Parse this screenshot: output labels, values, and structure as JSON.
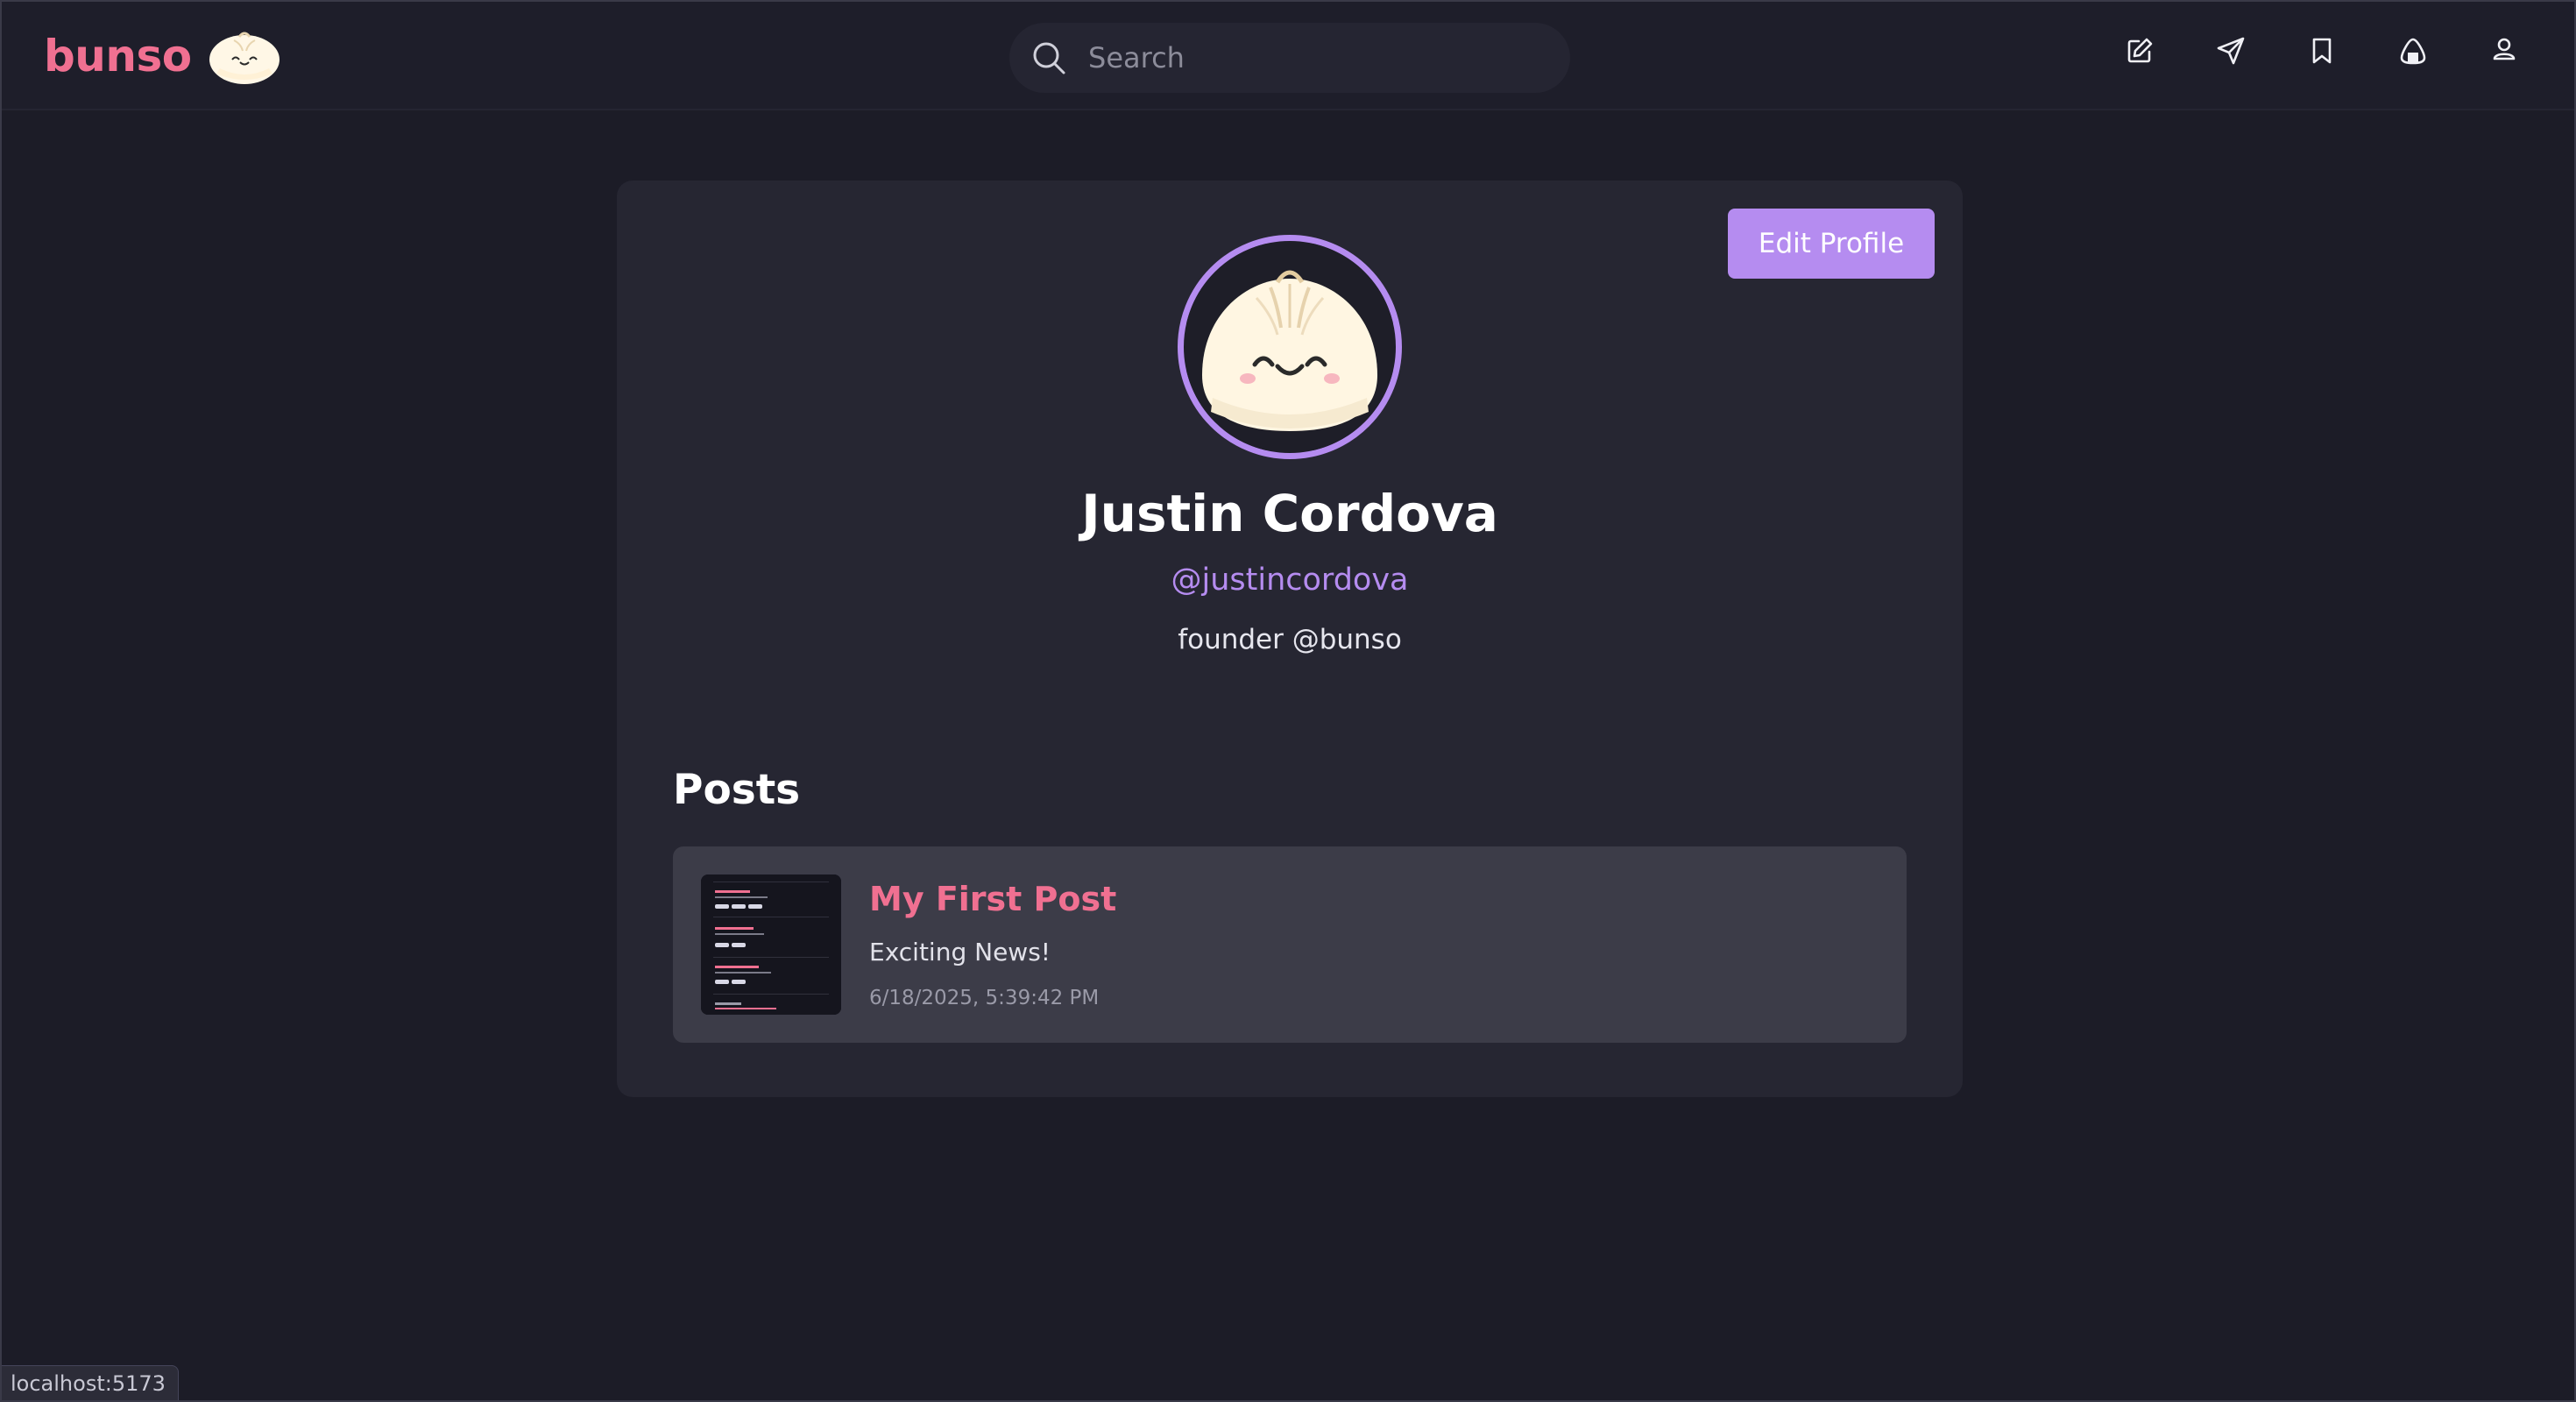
{
  "app": {
    "logo_text": "bunso"
  },
  "search": {
    "placeholder": "Search",
    "value": ""
  },
  "nav": {
    "icons": [
      "compose-icon",
      "send-icon",
      "bookmark-icon",
      "rice-ball-icon",
      "user-icon"
    ]
  },
  "profile": {
    "edit_label": "Edit Profile",
    "name": "Justin Cordova",
    "handle": "@justincordova",
    "bio": "founder @bunso"
  },
  "posts": {
    "heading": "Posts",
    "items": [
      {
        "title": "My First Post",
        "excerpt": "Exciting News!",
        "date": "6/18/2025, 5:39:42 PM"
      }
    ]
  },
  "status": {
    "url": "localhost:5173"
  },
  "colors": {
    "background": "#1c1c27",
    "card": "#262632",
    "post_card": "#3c3c48",
    "accent_pink": "#f07091",
    "accent_purple": "#b58cf0"
  }
}
